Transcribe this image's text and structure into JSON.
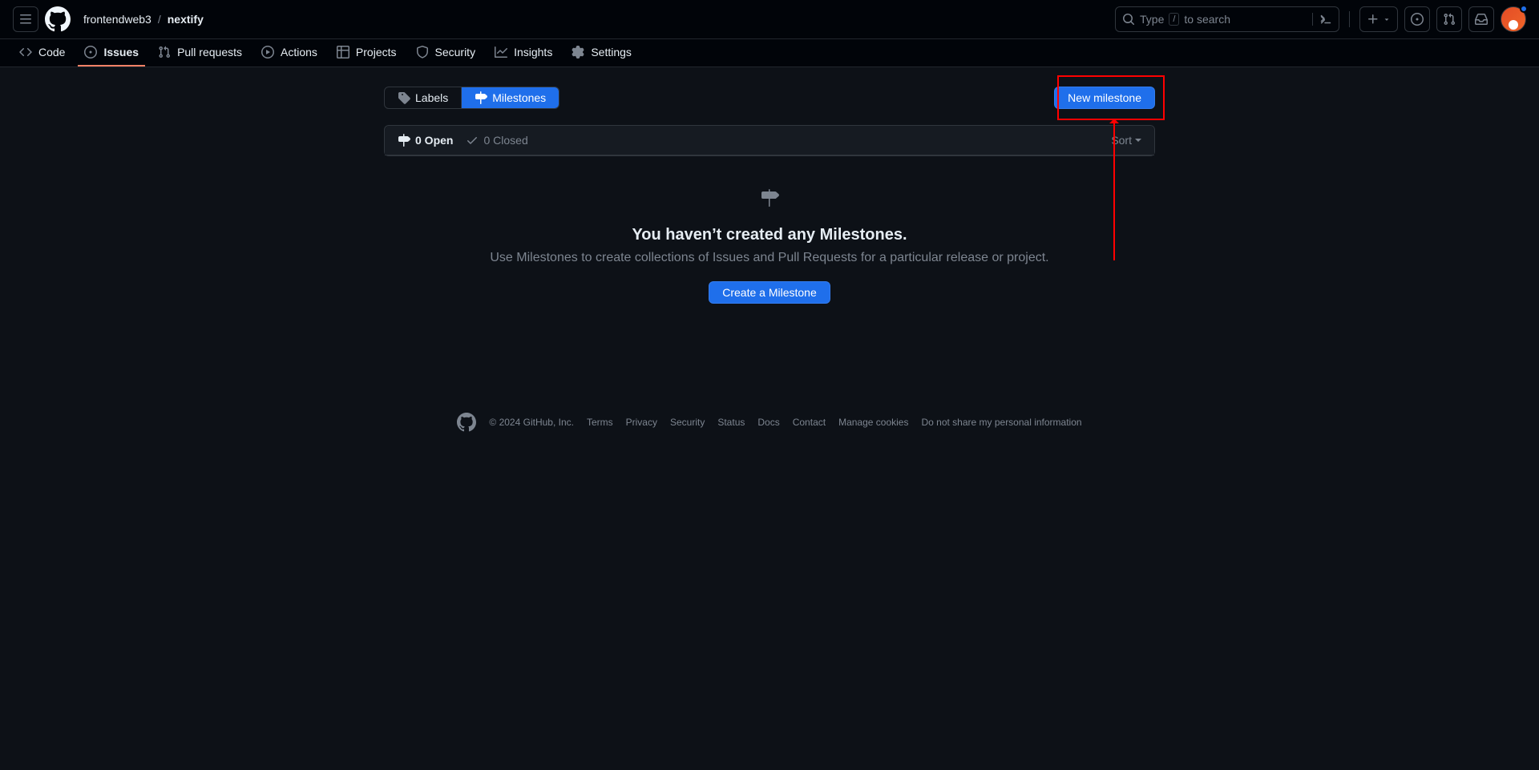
{
  "header": {
    "owner": "frontendweb3",
    "repo": "nextify",
    "search_prefix": "Type",
    "search_suffix": "to search",
    "search_key": "/"
  },
  "nav": {
    "code": "Code",
    "issues": "Issues",
    "pulls": "Pull requests",
    "actions": "Actions",
    "projects": "Projects",
    "security": "Security",
    "insights": "Insights",
    "settings": "Settings"
  },
  "subnav": {
    "labels": "Labels",
    "milestones": "Milestones",
    "new_milestone": "New milestone"
  },
  "states": {
    "open": "0 Open",
    "closed": "0 Closed",
    "sort": "Sort"
  },
  "blankslate": {
    "title": "You haven’t created any Milestones.",
    "description": "Use Milestones to create collections of Issues and Pull Requests for a particular release or project.",
    "cta": "Create a Milestone"
  },
  "footer": {
    "copyright": "© 2024 GitHub, Inc.",
    "links": [
      "Terms",
      "Privacy",
      "Security",
      "Status",
      "Docs",
      "Contact",
      "Manage cookies",
      "Do not share my personal information"
    ]
  }
}
